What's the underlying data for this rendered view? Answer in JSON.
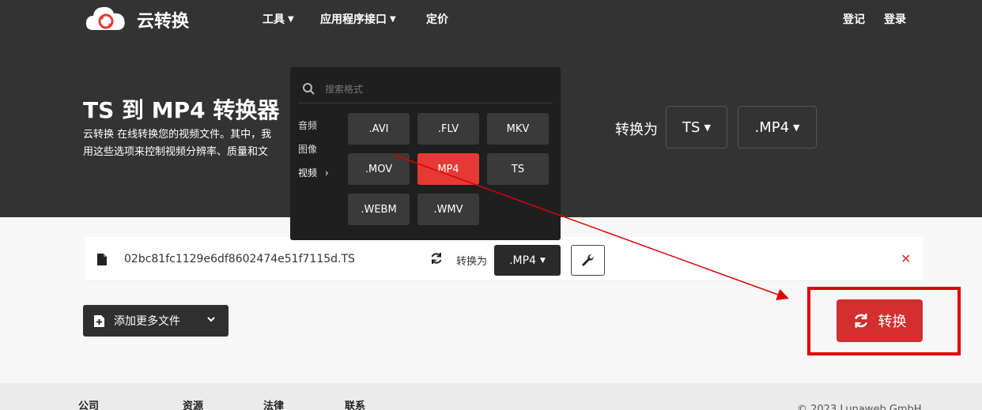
{
  "header": {
    "brand": "云转换",
    "nav": {
      "tools": "工具",
      "api": "应用程序接口",
      "pricing": "定价",
      "signup": "登记",
      "login": "登录"
    }
  },
  "hero": {
    "title": "TS 到 MP4 转换器",
    "desc_line1": "云转换 在线转换您的视频文件。其中，我",
    "desc_line2": "用这些选项来控制视频分辨率、质量和文",
    "convert_to_label": "转换为",
    "from_format": "TS",
    "to_format": ".MP4"
  },
  "dropdown": {
    "search_placeholder": "搜索格式",
    "categories": [
      "音频",
      "图像",
      "视频"
    ],
    "formats": [
      ".AVI",
      ".FLV",
      "MKV",
      ".MOV",
      "MP4",
      "TS",
      ".WEBM",
      ".WMV"
    ],
    "selected": "MP4"
  },
  "file_row": {
    "file_name": "02bc81fc1129e6df8602474e51f7115d.TS",
    "convert_to_label": "转换为",
    "target_format": ".MP4",
    "remove_label": "✕"
  },
  "actions": {
    "add_more_label": "添加更多文件",
    "convert_label": "转换"
  },
  "footer": {
    "company": "公司",
    "resources": "资源",
    "legal": "法律",
    "contact": "联系",
    "copyright": "© 2023 Lunaweb GmbH"
  },
  "colors": {
    "accent": "#d32f2f",
    "hero_bg": "#333333",
    "dropdown_bg": "#1f1f1f",
    "annotation": "#e00000"
  }
}
